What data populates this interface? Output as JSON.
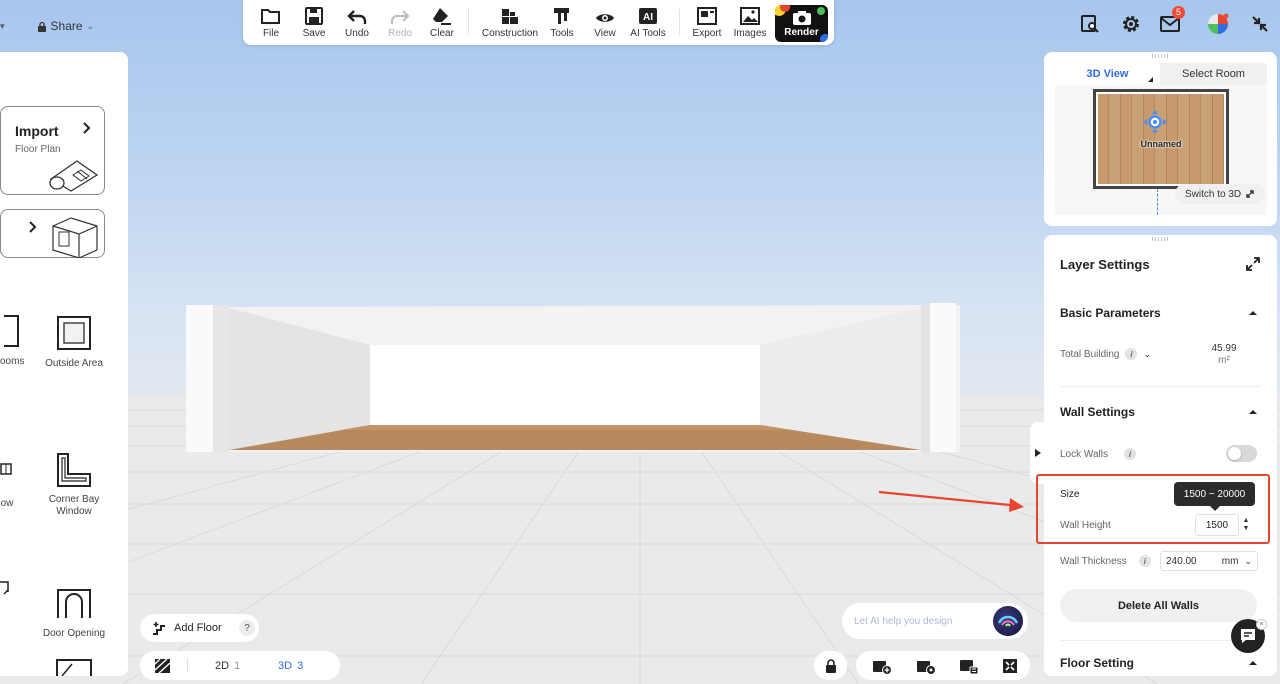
{
  "top_left": {
    "share_label": "Share"
  },
  "toolbar": {
    "file": "File",
    "save": "Save",
    "undo": "Undo",
    "redo": "Redo",
    "clear": "Clear",
    "construction": "Construction",
    "tools": "Tools",
    "view": "View",
    "ai_tools": "AI Tools",
    "export": "Export",
    "images": "Images",
    "render": "Render"
  },
  "top_right": {
    "mail_badge": "5"
  },
  "left_panel": {
    "import_card": {
      "title": "Import",
      "subtitle": "Floor Plan"
    },
    "items": {
      "rooms": "ooms",
      "outside_area": "Outside Area",
      "window_partial": "ow",
      "corner_bay_window": "Corner Bay Window",
      "door_opening": "Door Opening"
    }
  },
  "bottom_left": {
    "add_floor": "Add Floor",
    "help": "?",
    "view_2d": "2D",
    "view_2d_count": "1",
    "view_3d": "3D",
    "view_3d_count": "3"
  },
  "ai_input": {
    "placeholder": "Let AI help you design"
  },
  "minimap": {
    "tab_3d": "3D View",
    "tab_select": "Select Room",
    "room_label": "Unnamed",
    "switch_label": "Switch to 3D"
  },
  "settings": {
    "title": "Layer Settings",
    "basic_parameters": "Basic Parameters",
    "total_building_label": "Total Building",
    "total_building_value": "45.99",
    "total_building_unit": "m²",
    "wall_settings": "Wall Settings",
    "lock_walls": "Lock Walls",
    "lock_walls_on": false,
    "size_label": "Size",
    "wall_height_label": "Wall Height",
    "wall_height_value": "1500",
    "wall_height_range": "1500 ~ 20000",
    "wall_thickness_label": "Wall Thickness",
    "wall_thickness_value": "240.00",
    "wall_thickness_unit": "mm",
    "delete_all_walls": "Delete All Walls",
    "floor_setting": "Floor Setting"
  },
  "colors": {
    "accent": "#2f6de1",
    "annotation": "#e8452f",
    "badge": "#f04a3a"
  }
}
